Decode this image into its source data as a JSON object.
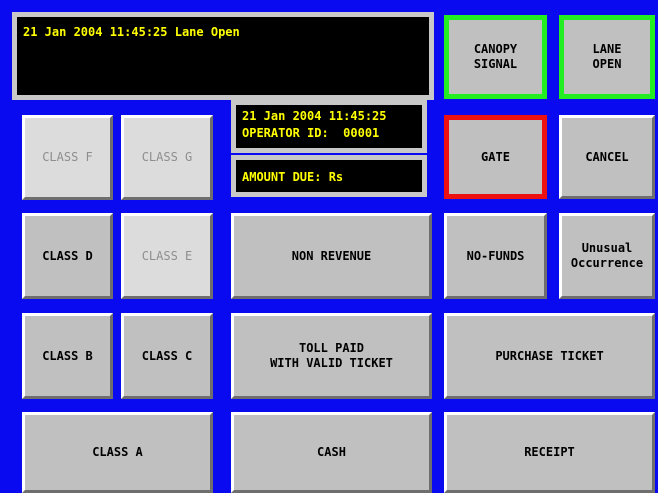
{
  "status_panel": {
    "text": "21 Jan 2004 11:45:25 Lane Open"
  },
  "info_panel": {
    "datetime": "21 Jan 2004 11:45:25",
    "operator": "OPERATOR ID:  00001"
  },
  "amount_panel": {
    "text": "AMOUNT DUE: Rs"
  },
  "buttons": {
    "canopy_signal": "CANOPY\nSIGNAL",
    "lane_open": "LANE\nOPEN",
    "gate": "GATE",
    "cancel": "CANCEL",
    "class_f": "CLASS F",
    "class_g": "CLASS G",
    "class_d": "CLASS D",
    "class_e": "CLASS E",
    "non_revenue": "NON REVENUE",
    "no_funds": "NO-FUNDS",
    "unusual_occurrence": "Unusual\nOccurrence",
    "class_b": "CLASS B",
    "class_c": "CLASS C",
    "toll_paid": "TOLL PAID\nWITH VALID TICKET",
    "purchase_ticket": "PURCHASE TICKET",
    "class_a": "CLASS A",
    "cash": "CASH",
    "receipt": "RECEIPT"
  },
  "colors": {
    "background": "#0a0af0",
    "display_text": "#ffff00",
    "canopy_border": "#22ee22",
    "gate_border": "#ee1111"
  }
}
